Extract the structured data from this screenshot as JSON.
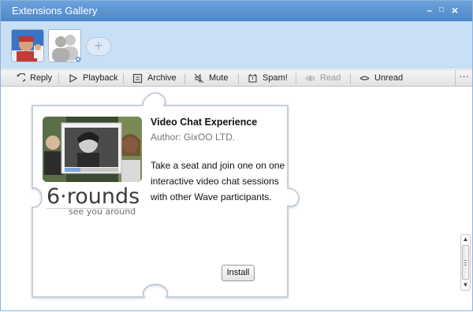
{
  "window": {
    "title": "Extensions Gallery",
    "controls": [
      {
        "name": "minimize",
        "glyph": "–"
      },
      {
        "name": "maximize",
        "glyph": "□"
      },
      {
        "name": "close",
        "glyph": "×"
      }
    ]
  },
  "participants": {
    "add_label": "+"
  },
  "toolbar": {
    "buttons": [
      {
        "name": "reply",
        "label": "Reply",
        "icon": "reply-icon",
        "enabled": true
      },
      {
        "name": "playback",
        "label": "Playback",
        "icon": "play-icon",
        "enabled": true
      },
      {
        "name": "archive",
        "label": "Archive",
        "icon": "archive-icon",
        "enabled": true
      },
      {
        "name": "mute",
        "label": "Mute",
        "icon": "mute-icon",
        "enabled": true
      },
      {
        "name": "spam",
        "label": "Spam!",
        "icon": "spam-icon",
        "enabled": true
      },
      {
        "name": "read",
        "label": "Read",
        "icon": "eye-icon",
        "enabled": false
      },
      {
        "name": "unread",
        "label": "Unread",
        "icon": "closed-eye-icon",
        "enabled": true
      }
    ],
    "more_label": "···"
  },
  "extension": {
    "title": "Video Chat Experience",
    "author": "Author: GixOO LTD.",
    "description": "Take a seat and join one on one interactive video chat sessions with other Wave participants.",
    "install_label": "Install",
    "logo_text": "6·rounds",
    "logo_tagline": "see you around"
  },
  "colors": {
    "titlebar": "#5590cf",
    "participants_bg": "#c9dff6",
    "toolbar_bg": "#ececec",
    "puzzle_border": "#b9c4d4"
  }
}
